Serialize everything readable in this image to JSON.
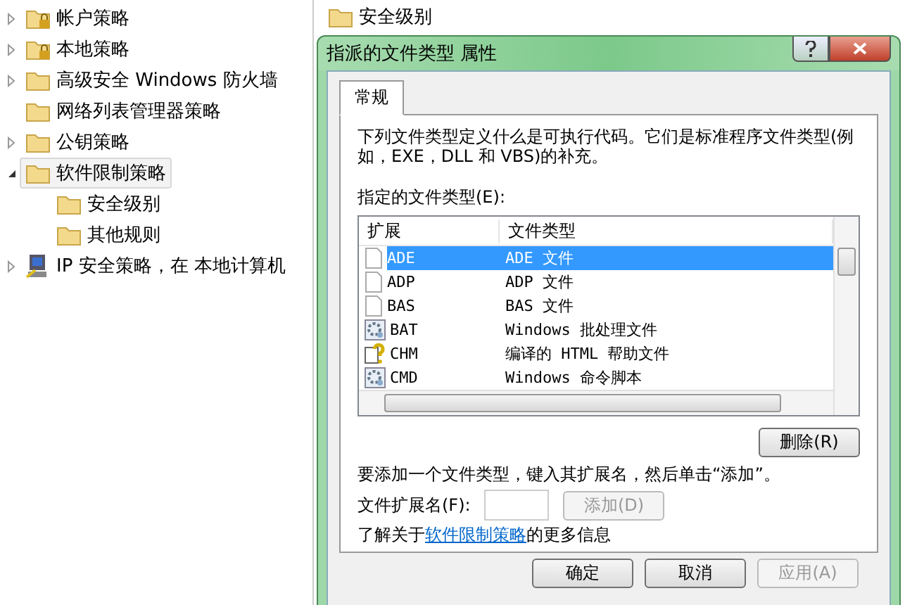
{
  "tree": [
    {
      "label": "帐户策略",
      "kind": "locked-folder",
      "expanded": false,
      "selected": false
    },
    {
      "label": "本地策略",
      "kind": "locked-folder",
      "expanded": false,
      "selected": false
    },
    {
      "label": "高级安全 Windows 防火墙",
      "kind": "folder",
      "expanded": false,
      "selected": false
    },
    {
      "label": "网络列表管理器策略",
      "kind": "folder",
      "selected": false
    },
    {
      "label": "公钥策略",
      "kind": "folder",
      "expanded": false,
      "selected": false
    },
    {
      "label": "软件限制策略",
      "kind": "folder",
      "expanded": true,
      "selected": true,
      "children": [
        {
          "label": "安全级别",
          "kind": "folder",
          "selected": false
        },
        {
          "label": "其他规则",
          "kind": "folder",
          "selected": false
        }
      ]
    },
    {
      "label": "IP 安全策略，在 本地计算机",
      "kind": "computer",
      "expanded": false,
      "selected": false
    }
  ],
  "details": {
    "items": [
      {
        "label": "安全级别"
      }
    ]
  },
  "dialog": {
    "title": "指派的文件类型 属性",
    "tabs": [
      {
        "label": "常规",
        "selected": true
      }
    ],
    "description": "下列文件类型定义什么是可执行代码。它们是标准程序文件类型(例如，EXE，DLL 和 VBS)的补充。",
    "list_label": "指定的文件类型(E):",
    "columns": [
      "扩展",
      "文件类型"
    ],
    "rows": [
      {
        "ext": "ADE",
        "type": "ADE 文件",
        "kind": "blank",
        "selected": true
      },
      {
        "ext": "ADP",
        "type": "ADP 文件",
        "kind": "blank",
        "selected": false
      },
      {
        "ext": "BAS",
        "type": "BAS 文件",
        "kind": "blank",
        "selected": false
      },
      {
        "ext": "BAT",
        "type": "Windows 批处理文件",
        "kind": "gear",
        "selected": false
      },
      {
        "ext": "CHM",
        "type": "编译的 HTML 帮助文件",
        "kind": "help",
        "selected": false
      },
      {
        "ext": "CMD",
        "type": "Windows 命令脚本",
        "kind": "gear",
        "selected": false
      }
    ],
    "delete_button": "删除(R)",
    "add_hint": "要添加一个文件类型，键入其扩展名，然后单击“添加”。",
    "extension_label": "文件扩展名(F):",
    "add_button": {
      "label": "添加(D)",
      "disabled": true
    },
    "learn_prefix": "了解关于",
    "learn_link": "软件限制策略",
    "learn_suffix": "的更多信息",
    "buttons": [
      {
        "label": "确定",
        "disabled": false
      },
      {
        "label": "取消",
        "disabled": false
      },
      {
        "label": "应用(A)",
        "disabled": true
      }
    ]
  }
}
